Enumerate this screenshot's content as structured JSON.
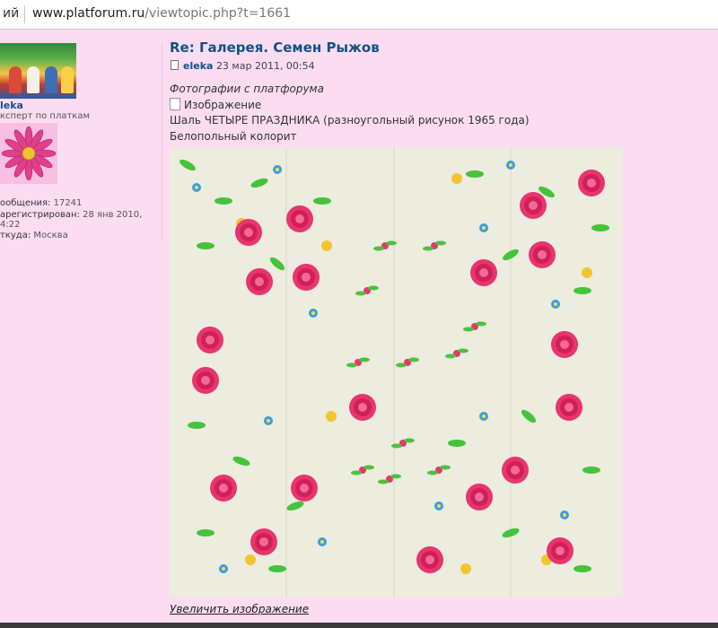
{
  "browser": {
    "tab_fragment": "ий",
    "url_host": "www.platforum.ru",
    "url_path": "/viewtopic.php?t=1661"
  },
  "user": {
    "name": "leka",
    "rank": "ксперт по платкам",
    "stats": [
      {
        "label": "ообщения:",
        "value": "17241"
      },
      {
        "label": "арегистрирован:",
        "value": "28 янв 2010,"
      },
      {
        "label": "",
        "value": "4:22"
      },
      {
        "label": "ткуда:",
        "value": "Москва"
      }
    ]
  },
  "post": {
    "title": "Re: Галерея. Семен Рыжов",
    "author": "eleka",
    "date": "23 мар 2011, 00:54",
    "italic_line": "Фотографии с платфорума",
    "image_alt": "Изображение",
    "line1": "Шаль ЧЕТЫРЕ ПРАЗДНИКА (разноугольный рисунок 1965 года)",
    "line2": "Белопольный колорит",
    "enlarge_link": "Увеличить изображение"
  },
  "colors": {
    "background": "#fcdcf1",
    "link": "#105289",
    "shawl_field": "#ececdf"
  }
}
